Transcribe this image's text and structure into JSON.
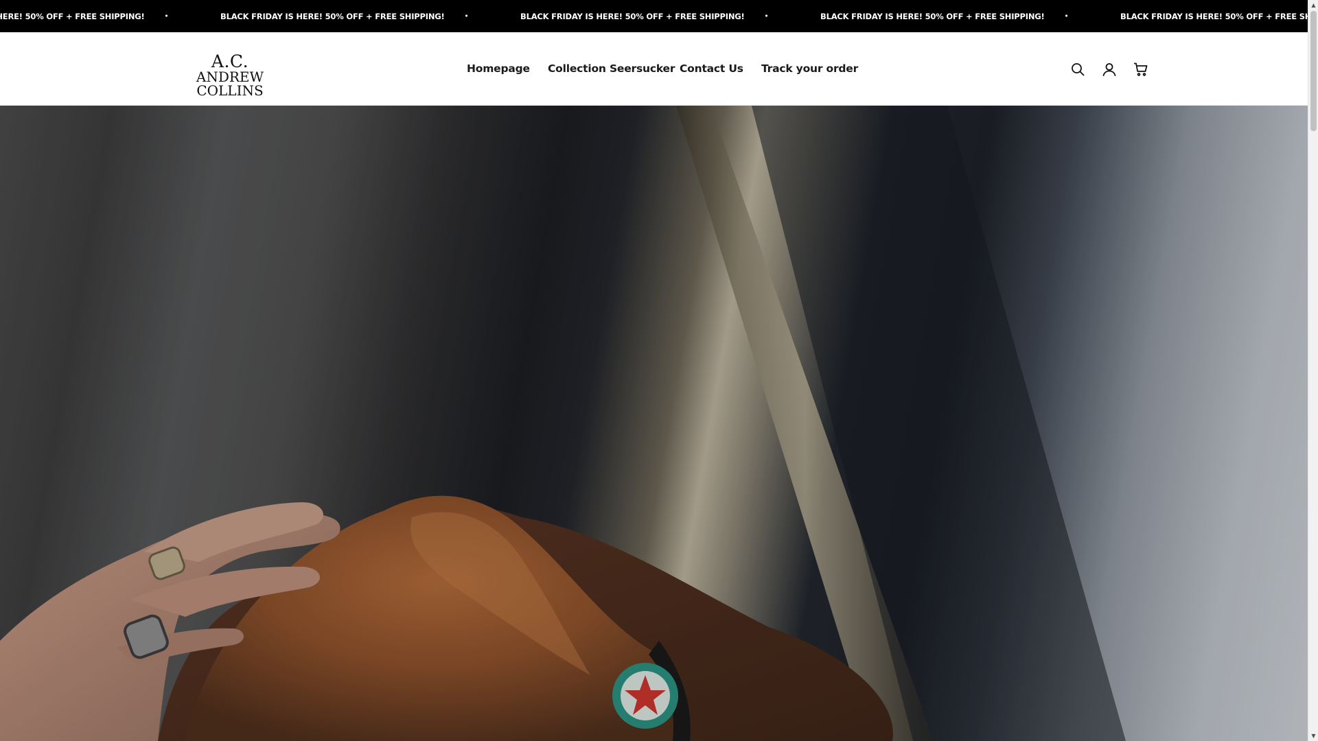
{
  "announcement": {
    "text": "BLACK FRIDAY IS HERE! 50% OFF + FREE SHIPPING!",
    "separator": "•"
  },
  "header": {
    "logo": {
      "monogram": "A.C.",
      "name": "ANDREW COLLINS"
    },
    "nav": [
      {
        "label": "Homepage"
      },
      {
        "label": "Collection Seersucker"
      },
      {
        "label": "Contact Us"
      },
      {
        "label": "Track your order"
      }
    ],
    "icons": [
      "search-icon",
      "account-icon",
      "cart-icon"
    ]
  },
  "colors": {
    "announcement_bg": "#000000",
    "announcement_text": "#ffffff",
    "header_bg": "#ffffff",
    "nav_text": "#1a1a1a"
  },
  "hero": {
    "image": "man-holding-brown-felt-hat"
  }
}
